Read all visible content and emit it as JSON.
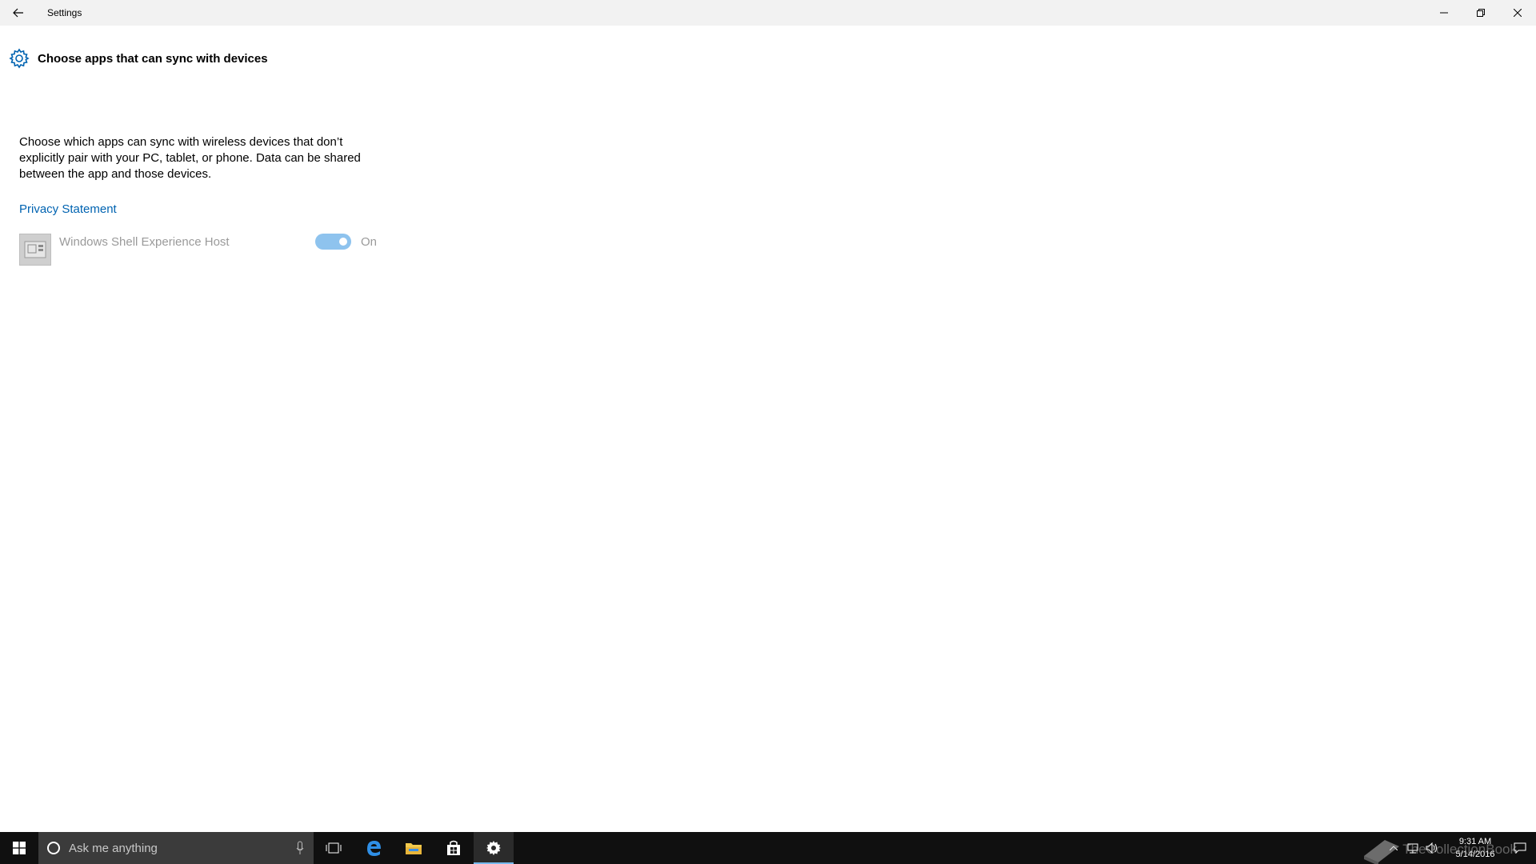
{
  "window": {
    "title": "Settings"
  },
  "page": {
    "title": "Choose apps that can sync with devices",
    "description": "Choose which apps can sync with wireless devices that don’t explicitly pair with your PC, tablet, or phone. Data can be shared between the app and those devices.",
    "privacy_link": "Privacy Statement"
  },
  "apps": [
    {
      "name": "Windows Shell Experience Host",
      "toggle_state": "On",
      "enabled": true
    }
  ],
  "taskbar": {
    "search_placeholder": "Ask me anything",
    "items": [
      "task-view-icon",
      "edge-icon",
      "file-explorer-icon",
      "store-icon",
      "settings-icon"
    ],
    "active_item": "settings-icon"
  },
  "tray": {
    "time": "9:31 AM",
    "date": "5/14/2016",
    "watermark": "TheCollectionBook"
  },
  "colors": {
    "accent": "#0063b1",
    "toggle_on": "#8ec3ee",
    "titlebar": "#f2f2f2",
    "taskbar": "#101010"
  }
}
